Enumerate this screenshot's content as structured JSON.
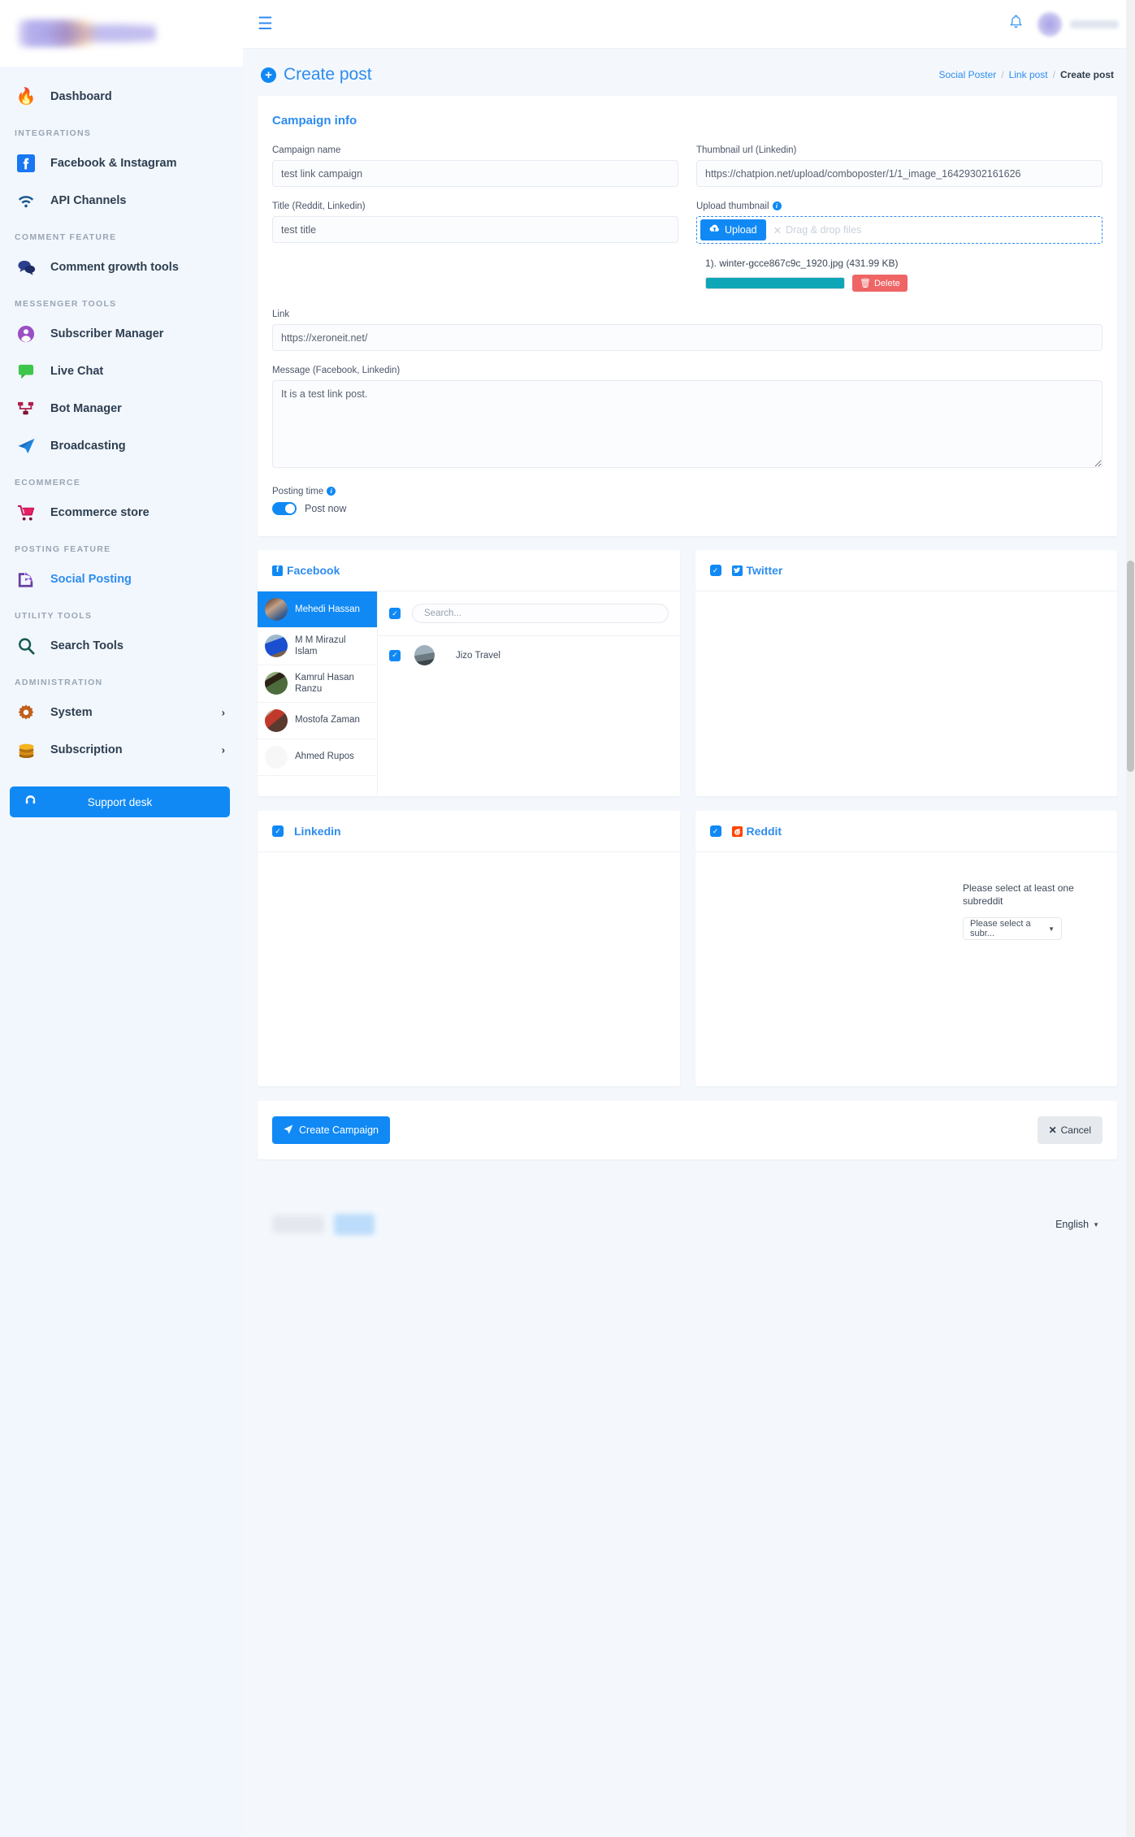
{
  "brand": {
    "logo_alt": "ChatPion logo"
  },
  "sidebar": {
    "groups": [
      {
        "label": "",
        "items": [
          {
            "icon": "flame-icon",
            "glyph": "🔥",
            "label": "Dashboard",
            "active": false,
            "chevron": false
          }
        ]
      },
      {
        "label": "INTEGRATIONS",
        "items": [
          {
            "icon": "facebook-icon",
            "glyph": "f",
            "label": "Facebook & Instagram",
            "active": false,
            "chevron": false
          },
          {
            "icon": "wifi-icon",
            "glyph": "📶",
            "label": "API Channels",
            "active": false,
            "chevron": false
          }
        ]
      },
      {
        "label": "COMMENT FEATURE",
        "items": [
          {
            "icon": "comments-icon",
            "glyph": "💬",
            "label": "Comment growth tools",
            "active": false,
            "chevron": false
          }
        ]
      },
      {
        "label": "MESSENGER TOOLS",
        "items": [
          {
            "icon": "user-circle-icon",
            "glyph": "👤",
            "label": "Subscriber Manager",
            "active": false,
            "chevron": false
          },
          {
            "icon": "chat-bubble-icon",
            "glyph": "💬",
            "label": "Live Chat",
            "active": false,
            "chevron": false
          },
          {
            "icon": "sitemap-icon",
            "glyph": "⑂",
            "label": "Bot Manager",
            "active": false,
            "chevron": false
          },
          {
            "icon": "paper-plane-icon",
            "glyph": "➤",
            "label": "Broadcasting",
            "active": false,
            "chevron": false
          }
        ]
      },
      {
        "label": "ECOMMERCE",
        "items": [
          {
            "icon": "shopping-cart-icon",
            "glyph": "🛒",
            "label": "Ecommerce store",
            "active": false,
            "chevron": false
          }
        ]
      },
      {
        "label": "POSTING FEATURE",
        "items": [
          {
            "icon": "share-square-icon",
            "glyph": "↱",
            "label": "Social Posting",
            "active": true,
            "chevron": false
          }
        ]
      },
      {
        "label": "UTILITY TOOLS",
        "items": [
          {
            "icon": "search-icon",
            "glyph": "🔍",
            "label": "Search Tools",
            "active": false,
            "chevron": false
          }
        ]
      },
      {
        "label": "ADMINISTRATION",
        "items": [
          {
            "icon": "gear-icon",
            "glyph": "⚙",
            "label": "System",
            "active": false,
            "chevron": true
          },
          {
            "icon": "coins-icon",
            "glyph": "💰",
            "label": "Subscription",
            "active": false,
            "chevron": true
          }
        ]
      }
    ],
    "support_label": "Support desk"
  },
  "topbar": {
    "menu_icon": "hamburger-icon",
    "bell_icon": "bell-icon",
    "avatar_icon": "avatar"
  },
  "page": {
    "title": "Create post",
    "breadcrumb": {
      "root": "Social Poster",
      "middle": "Link post",
      "current": "Create post"
    }
  },
  "campaign": {
    "section_title": "Campaign info",
    "campaign_name_label": "Campaign name",
    "campaign_name_value": "test link campaign",
    "campaign_name_placeholder": "Campaign name",
    "title_label": "Title (Reddit, Linkedin)",
    "title_value": "test title",
    "title_placeholder": "Title",
    "thumbnail_url_label": "Thumbnail url (Linkedin)",
    "thumbnail_url_value": "https://chatpion.net/upload/comboposter/1/1_image_16429302161626",
    "thumbnail_url_placeholder": "Thumbnail url",
    "upload_thumbnail_label": "Upload thumbnail",
    "upload_button": "Upload",
    "dropzone_hint": "Drag & drop files",
    "file_name": "1). winter-gcce867c9c_1920.jpg (431.99 KB)",
    "delete_button": "Delete",
    "link_label": "Link",
    "link_value": "https://xeroneit.net/",
    "link_placeholder": "Link",
    "message_label": "Message (Facebook, Linkedin)",
    "message_value": "It is a test link post.",
    "message_placeholder": "Message",
    "posting_time_label": "Posting time",
    "post_now_label": "Post now"
  },
  "platforms": {
    "facebook": {
      "name": "Facebook",
      "icon": "facebook-icon",
      "checked": false,
      "accounts": [
        {
          "name": "Mehedi Hassan",
          "selected": true
        },
        {
          "name": "M M Mirazul Islam",
          "selected": false
        },
        {
          "name": "Kamrul Hasan Ranzu",
          "selected": false
        },
        {
          "name": "Mostofa Zaman",
          "selected": false
        },
        {
          "name": "Ahmed Rupos",
          "selected": false
        }
      ],
      "search_placeholder": "Search...",
      "search_checked": true,
      "pages": [
        {
          "name": "Jizo Travel",
          "checked": true
        }
      ]
    },
    "twitter": {
      "name": "Twitter",
      "icon": "twitter-icon",
      "checked": true
    },
    "linkedin": {
      "name": "Linkedin",
      "icon": "linkedin-icon",
      "checked": true
    },
    "reddit": {
      "name": "Reddit",
      "icon": "reddit-icon",
      "checked": true,
      "message": "Please select at least one subreddit",
      "select_value": "Please select a subr..."
    }
  },
  "actions": {
    "create_label": "Create Campaign",
    "cancel_label": "Cancel"
  },
  "footer": {
    "language": "English"
  }
}
